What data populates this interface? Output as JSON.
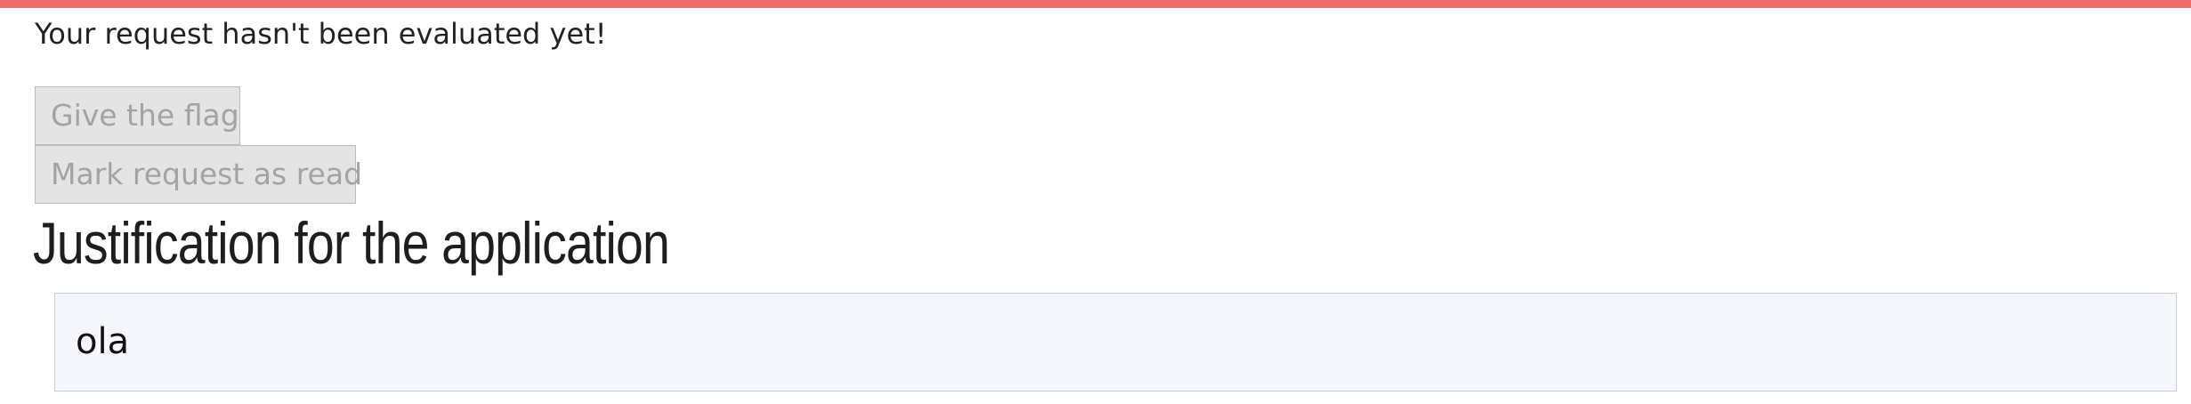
{
  "theme": {
    "accent_bar_color": "#ef6c6c",
    "button_background": "#e4e4e4",
    "button_text_color": "#a3a3a3",
    "box_background": "#f6f7fc"
  },
  "status": {
    "message": "Your request hasn't been evaluated yet!"
  },
  "actions": {
    "give_flag_label": "Give the flag",
    "mark_read_label": "Mark request as read"
  },
  "justification": {
    "heading": "Justification for the application",
    "text": "ola"
  }
}
